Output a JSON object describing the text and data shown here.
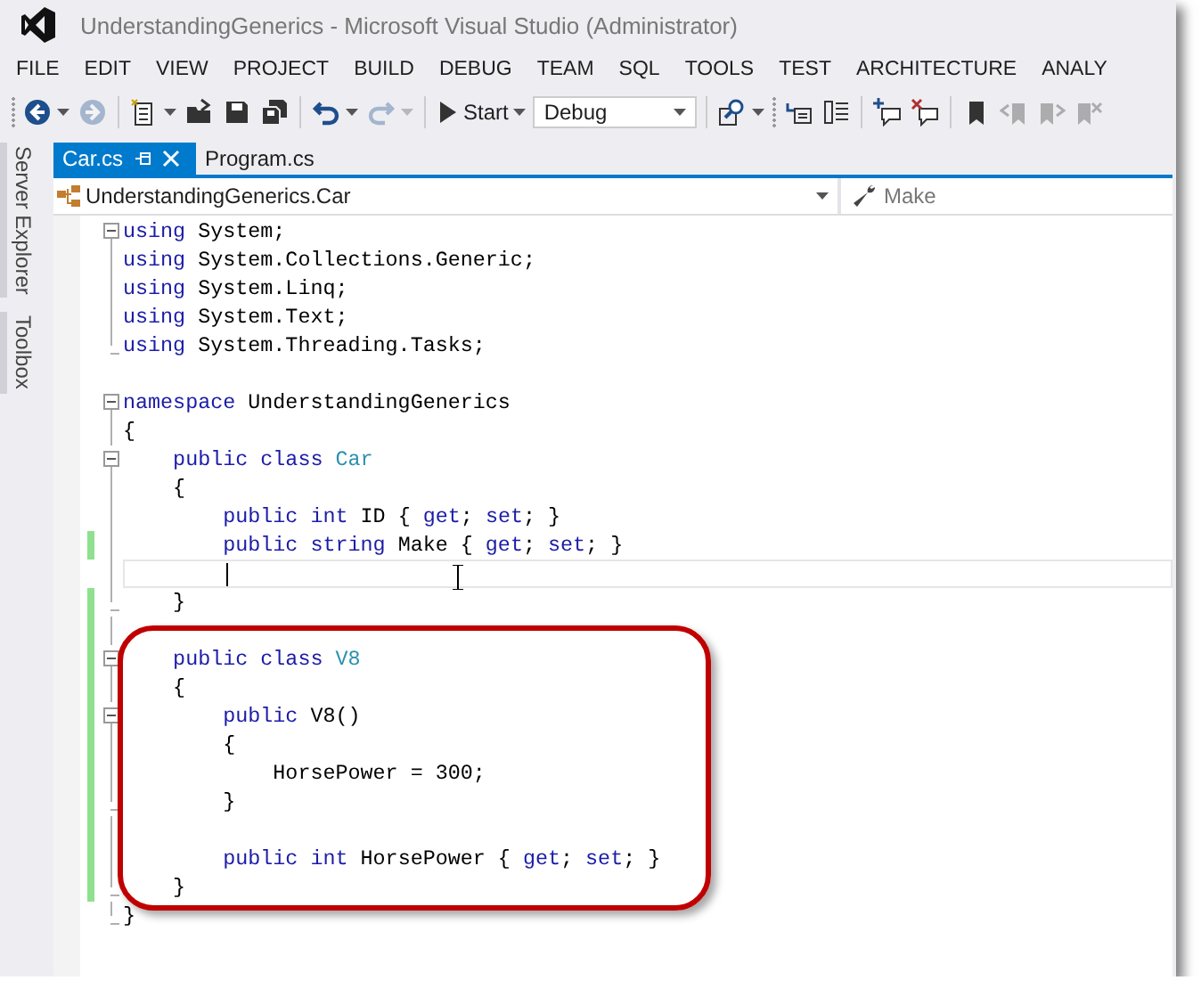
{
  "window": {
    "title": "UnderstandingGenerics - Microsoft Visual Studio (Administrator)"
  },
  "menu": [
    "FILE",
    "EDIT",
    "VIEW",
    "PROJECT",
    "BUILD",
    "DEBUG",
    "TEAM",
    "SQL",
    "TOOLS",
    "TEST",
    "ARCHITECTURE",
    "ANALY"
  ],
  "toolbar": [
    {
      "kind": "back",
      "disabled": false
    },
    {
      "kind": "forward",
      "disabled": true
    },
    {
      "kind": "separator"
    },
    {
      "kind": "new",
      "disabled": false
    },
    {
      "kind": "open",
      "disabled": false
    },
    {
      "kind": "save",
      "disabled": false
    },
    {
      "kind": "saveall",
      "disabled": false
    },
    {
      "kind": "separator"
    },
    {
      "kind": "undo",
      "disabled": false
    },
    {
      "kind": "redo",
      "disabled": true
    },
    {
      "kind": "separator"
    },
    {
      "kind": "start",
      "label": "Start",
      "disabled": false
    },
    {
      "kind": "dropdown",
      "value": "Debug"
    },
    {
      "kind": "separator"
    },
    {
      "kind": "find",
      "disabled": false
    },
    {
      "kind": "grip"
    },
    {
      "kind": "indent",
      "disabled": false
    },
    {
      "kind": "members",
      "disabled": false
    },
    {
      "kind": "separator"
    },
    {
      "kind": "comment",
      "disabled": false
    },
    {
      "kind": "uncomment",
      "disabled": false
    },
    {
      "kind": "separator"
    },
    {
      "kind": "bookmark",
      "disabled": false
    },
    {
      "kind": "bookmark-prev",
      "disabled": true
    },
    {
      "kind": "bookmark-next",
      "disabled": true
    },
    {
      "kind": "bookmark-clear",
      "disabled": true
    }
  ],
  "side_tabs": [
    "Server Explorer",
    "Toolbox"
  ],
  "tabs": [
    {
      "label": "Car.cs",
      "selected": true
    },
    {
      "label": "Program.cs",
      "selected": false
    }
  ],
  "nav_bar": {
    "type": "UnderstandingGenerics.Car",
    "member": "Make"
  },
  "code": [
    {
      "kind": "fold-start",
      "changed": false,
      "segments": [
        {
          "kind": "keyword",
          "text": "using"
        },
        {
          "kind": "plain",
          "text": " System;"
        }
      ]
    },
    {
      "kind": "fold-inner",
      "changed": false,
      "segments": [
        {
          "kind": "keyword",
          "text": "using"
        },
        {
          "kind": "plain",
          "text": " System.Collections.Generic;"
        }
      ]
    },
    {
      "kind": "fold-inner",
      "changed": false,
      "segments": [
        {
          "kind": "keyword",
          "text": "using"
        },
        {
          "kind": "plain",
          "text": " System.Linq;"
        }
      ]
    },
    {
      "kind": "fold-inner",
      "changed": false,
      "segments": [
        {
          "kind": "keyword",
          "text": "using"
        },
        {
          "kind": "plain",
          "text": " System.Text;"
        }
      ]
    },
    {
      "kind": "fold-end",
      "changed": false,
      "segments": [
        {
          "kind": "keyword",
          "text": "using"
        },
        {
          "kind": "plain",
          "text": " System.Threading.Tasks;"
        }
      ]
    },
    {
      "kind": "plain",
      "changed": false
    },
    {
      "kind": "fold-start",
      "changed": false,
      "segments": [
        {
          "kind": "keyword",
          "text": "namespace"
        },
        {
          "kind": "plain",
          "text": " UnderstandingGenerics"
        }
      ]
    },
    {
      "kind": "fold-inner",
      "changed": false,
      "segments": [
        {
          "kind": "plain",
          "text": "{"
        }
      ]
    },
    {
      "kind": "fold-start",
      "changed": false,
      "segments": [
        {
          "kind": "keyword",
          "text": "    public "
        },
        {
          "kind": "keyword",
          "text": "class "
        },
        {
          "kind": "type",
          "text": "Car"
        }
      ]
    },
    {
      "kind": "fold-inner",
      "changed": false,
      "segments": [
        {
          "kind": "plain",
          "text": "    {"
        }
      ]
    },
    {
      "kind": "fold-inner",
      "changed": false,
      "segments": [
        {
          "kind": "keyword",
          "text": "        public "
        },
        {
          "kind": "keyword",
          "text": "int"
        },
        {
          "kind": "plain",
          "text": " ID { "
        },
        {
          "kind": "keyword",
          "text": "get"
        },
        {
          "kind": "plain",
          "text": "; "
        },
        {
          "kind": "keyword",
          "text": "set"
        },
        {
          "kind": "plain",
          "text": "; }"
        }
      ]
    },
    {
      "kind": "fold-inner",
      "changed": true,
      "segments": [
        {
          "kind": "keyword",
          "text": "        public "
        },
        {
          "kind": "keyword",
          "text": "string"
        },
        {
          "kind": "plain",
          "text": " Make { "
        },
        {
          "kind": "keyword",
          "text": "get"
        },
        {
          "kind": "plain",
          "text": "; "
        },
        {
          "kind": "keyword",
          "text": "set"
        },
        {
          "kind": "plain",
          "text": "; }"
        }
      ]
    },
    {
      "kind": "fold-inner",
      "changed": false,
      "current": true
    },
    {
      "kind": "fold-end",
      "changed": true,
      "segments": [
        {
          "kind": "plain",
          "text": "    }"
        }
      ]
    },
    {
      "kind": "fold-inner",
      "changed": true
    },
    {
      "kind": "fold-start",
      "changed": true,
      "segments": [
        {
          "kind": "keyword",
          "text": "    public "
        },
        {
          "kind": "keyword",
          "text": "class "
        },
        {
          "kind": "type",
          "text": "V8"
        }
      ]
    },
    {
      "kind": "fold-inner",
      "changed": true,
      "segments": [
        {
          "kind": "plain",
          "text": "    {"
        }
      ]
    },
    {
      "kind": "fold-start",
      "changed": true,
      "segments": [
        {
          "kind": "keyword",
          "text": "        public"
        },
        {
          "kind": "plain",
          "text": " V8()"
        }
      ]
    },
    {
      "kind": "fold-inner",
      "changed": true,
      "segments": [
        {
          "kind": "plain",
          "text": "        {"
        }
      ]
    },
    {
      "kind": "fold-inner",
      "changed": true,
      "segments": [
        {
          "kind": "plain",
          "text": "            HorsePower = 300;"
        }
      ]
    },
    {
      "kind": "fold-end",
      "changed": true,
      "segments": [
        {
          "kind": "plain",
          "text": "        }"
        }
      ]
    },
    {
      "kind": "fold-inner",
      "changed": true
    },
    {
      "kind": "fold-inner",
      "changed": true,
      "segments": [
        {
          "kind": "keyword",
          "text": "        public "
        },
        {
          "kind": "keyword",
          "text": "int"
        },
        {
          "kind": "plain",
          "text": " HorsePower { "
        },
        {
          "kind": "keyword",
          "text": "get"
        },
        {
          "kind": "plain",
          "text": "; "
        },
        {
          "kind": "keyword",
          "text": "set"
        },
        {
          "kind": "plain",
          "text": "; }"
        }
      ]
    },
    {
      "kind": "fold-end",
      "changed": true,
      "segments": [
        {
          "kind": "plain",
          "text": "    }"
        }
      ]
    },
    {
      "kind": "fold-end",
      "changed": false,
      "segments": [
        {
          "kind": "plain",
          "text": "}"
        }
      ]
    }
  ]
}
